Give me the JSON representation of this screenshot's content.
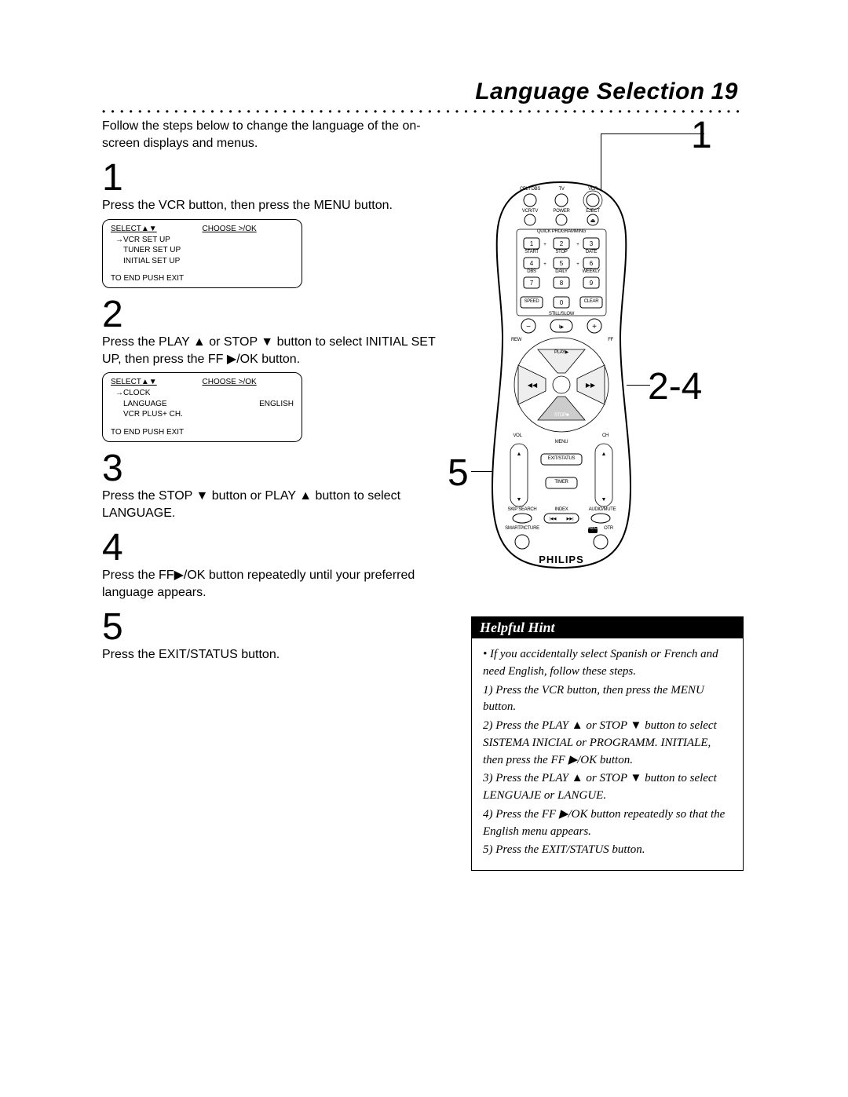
{
  "header": {
    "title": "Language Selection",
    "page_num": "19"
  },
  "intro": "Follow the steps below to change the language of the on-screen displays and menus.",
  "steps": [
    {
      "num": "1",
      "text": "Press the VCR button, then press the MENU button."
    },
    {
      "num": "2",
      "text": "Press the PLAY  ▲ or STOP  ▼ button to select INITIAL SET UP, then press the FF  ▶/OK button."
    },
    {
      "num": "3",
      "text": "Press the STOP  ▼ button or PLAY   ▲ button to select LANGUAGE."
    },
    {
      "num": "4",
      "text": "Press the FF▶/OK button repeatedly until your preferred language appears."
    },
    {
      "num": "5",
      "text": "Press the EXIT/STATUS   button."
    }
  ],
  "osd1": {
    "head_left": "SELECT▲▼",
    "head_right": "CHOOSE >/OK",
    "items": [
      {
        "arrow": "→",
        "label": "VCR SET UP",
        "value": ""
      },
      {
        "arrow": "",
        "label": "TUNER SET UP",
        "value": ""
      },
      {
        "arrow": "",
        "label": "INITIAL SET UP",
        "value": ""
      }
    ],
    "footer": "TO END PUSH EXIT"
  },
  "osd2": {
    "head_left": "SELECT▲▼",
    "head_right": "CHOOSE >/OK",
    "items": [
      {
        "arrow": "→",
        "label": "CLOCK",
        "value": ""
      },
      {
        "arrow": "",
        "label": "LANGUAGE",
        "value": "ENGLISH"
      },
      {
        "arrow": "",
        "label": "VCR PLUS+ CH.",
        "value": ""
      }
    ],
    "footer": "TO END PUSH EXIT"
  },
  "hint": {
    "title": "Helpful Hint",
    "lines": [
      "•  If you accidentally select Spanish or French and need English, follow these steps.",
      "1) Press the VCR button, then press the MENU button.",
      "2) Press the PLAY ▲ or STOP ▼ button to select SISTEMA INICIAL or PROGRAMM. INITIALE, then press the FF ▶/OK button.",
      "3) Press the PLAY ▲ or STOP ▼ button to select LENGUAJE or LANGUE.",
      "4) Press the FF ▶/OK button repeatedly so that the English menu appears.",
      "5) Press the EXIT/STATUS button."
    ]
  },
  "callouts": {
    "c1": "1",
    "c24": "2-4",
    "c5": "5"
  },
  "remote": {
    "brand": "PHILIPS",
    "top_row": [
      "CBL / DBS",
      "TV",
      "VCR"
    ],
    "row2": [
      "VCR/TV",
      "POWER",
      "EJECT"
    ],
    "quick": "QUICK PROGRAMMING",
    "numpad": [
      "1",
      "2",
      "3",
      "4",
      "5",
      "6",
      "7",
      "8",
      "9"
    ],
    "row_labels_1": [
      "START",
      "STOP",
      "DATE"
    ],
    "row_labels_2": [
      "DBS",
      "DAILY",
      "WEEKLY"
    ],
    "speed": "SPEED",
    "zero": "0",
    "clear": "CLEAR",
    "stillslow": "STILL/SLOW",
    "rew": "REW",
    "ff": "FF",
    "play": "PLAY▶",
    "stop": "STOP■",
    "vol": "VOL",
    "ch": "CH",
    "menu": "MENU",
    "exit": "EXIT/STATUS",
    "timer": "TIMER",
    "skip": "SKIP SEARCH",
    "index": "INDEX",
    "audio": "AUDIO/MUTE",
    "smart": "SMARTPICTURE",
    "otr": "OTR",
    "rec": "REC",
    "minus": "−",
    "plus": "+",
    "frame": "I▶",
    "rewind_sym": "◀◀",
    "ff_sym": "▶▶",
    "up": "▲",
    "down": "▼",
    "plus_sign": "+",
    "minus_sign": "−",
    "dot": "•"
  }
}
